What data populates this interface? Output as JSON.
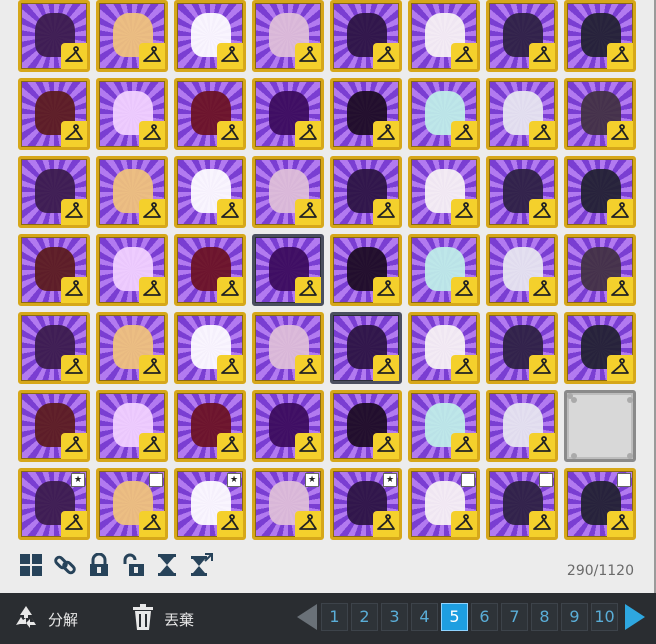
{
  "inventory": {
    "counter": "290/1120",
    "rows": [
      [
        "hooded-cloak",
        "butterfly-wings",
        "star-constellation",
        "magic-circle",
        "dark-wings",
        "white-mask",
        "feather-wings",
        "jeweled-staff"
      ],
      [
        "dark-phoenix-wings",
        "light-sparkle",
        "red-rose",
        "dark-star-aura",
        "dark-lace-hat",
        "ice-crystal-wings",
        "white-tiara",
        "cosmic-ring"
      ],
      [
        "golden-halo",
        "blue-fairy-wings",
        "santa-hat-item",
        "dark-eye-mask-cyan",
        "dark-eye-mask-red",
        "red-dress",
        "dark-mecha-wings",
        "white-hood-girl"
      ],
      [
        "fire-sun",
        "bone-dragon-wings",
        "dark-gauntlet",
        "blue-vortex",
        "red-flower-staff",
        "mecha-sword",
        "angel-armor",
        "blue-crown-aura"
      ],
      [
        "blue-coat",
        "teal-magic-circle",
        "sunglasses",
        "dark-fox-mask",
        "red-scythe",
        "green-dragon-wings",
        "teal-armor",
        "silver-crown"
      ],
      [
        "denim-shorts",
        "fur-boots",
        "brown-boots",
        "red-white-skirt",
        "dark-boots",
        "white-fur-boots",
        "white-stockings",
        "empty-slot"
      ],
      [
        "blonde-hair",
        "silver-hair",
        "white-hair",
        "black-ponytail",
        "black-hair",
        "black-twintail",
        "dark-curly-hair",
        "pink-flower-hair"
      ]
    ],
    "row6_badges": [
      "★",
      "",
      "★",
      "★",
      "★",
      "",
      "",
      ""
    ]
  },
  "toolbar": {
    "icons": [
      "grid-icon",
      "link-icon",
      "lock-icon",
      "unlock-icon",
      "hourglass-icon",
      "hourglass-export-icon"
    ]
  },
  "bottom": {
    "decompose_label": "分解",
    "discard_label": "丟棄"
  },
  "pager": {
    "pages": [
      "1",
      "2",
      "3",
      "4",
      "5",
      "6",
      "7",
      "8",
      "9",
      "10"
    ],
    "active": "5"
  }
}
